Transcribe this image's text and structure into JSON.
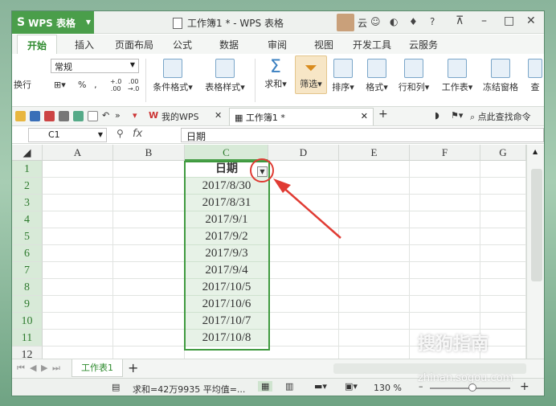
{
  "app": {
    "name": "WPS 表格",
    "title": "工作簿1 * - WPS 表格",
    "user": "云"
  },
  "tabs": [
    "开始",
    "插入",
    "页面布局",
    "公式",
    "数据",
    "审阅",
    "视图",
    "开发工具",
    "云服务"
  ],
  "ribbon": {
    "wrap_label": "换行",
    "number_format": "常规",
    "percent": "%",
    "thousands": "‚",
    "items": [
      "条件格式",
      "表格样式",
      "求和",
      "筛选",
      "排序",
      "格式",
      "行和列",
      "工作表",
      "冻结窗格",
      "查"
    ]
  },
  "doc_tabs": {
    "my_wps": "我的WPS",
    "workbook": "工作簿1 *",
    "find": "点此查找命令"
  },
  "formula_bar": {
    "name_box": "C1",
    "fx": "fx",
    "formula": "日期"
  },
  "grid": {
    "columns": [
      "A",
      "B",
      "C",
      "D",
      "E",
      "F",
      "G"
    ],
    "rows": [
      "1",
      "2",
      "3",
      "4",
      "5",
      "6",
      "7",
      "8",
      "9",
      "10",
      "11",
      "12"
    ],
    "c_values": [
      "日期",
      "2017/8/30",
      "2017/8/31",
      "2017/9/1",
      "2017/9/2",
      "2017/9/3",
      "2017/9/4",
      "2017/10/5",
      "2017/10/6",
      "2017/10/7",
      "2017/10/8"
    ]
  },
  "sheets": {
    "active": "工作表1",
    "add": "+"
  },
  "status": {
    "sum": "求和=42万9935  平均值=...",
    "zoom": "130 %"
  },
  "watermark": {
    "brand": "搜狗指南",
    "url": "zhinan.sogou.com"
  },
  "colors": {
    "brand_green": "#4a9e4a",
    "select_green": "#3f9a3f",
    "annotation_red": "#e03b33"
  }
}
